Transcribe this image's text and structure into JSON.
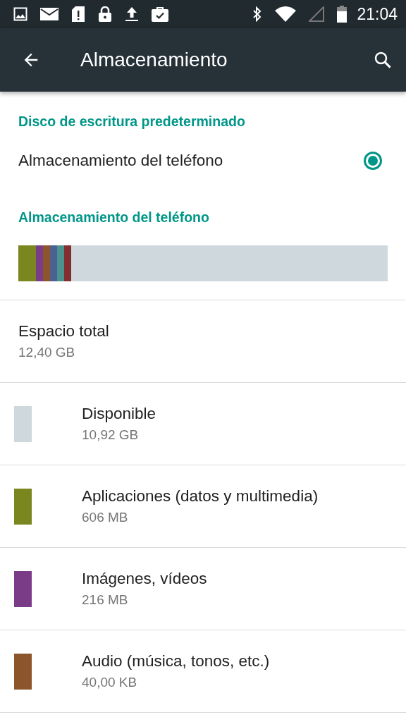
{
  "status_bar": {
    "time": "21:04"
  },
  "app_bar": {
    "title": "Almacenamiento"
  },
  "default_disk": {
    "header": "Disco de escritura predeterminado",
    "options": [
      {
        "label": "Almacenamiento del teléfono",
        "selected": true
      }
    ]
  },
  "phone_storage": {
    "header": "Almacenamiento del teléfono",
    "usage_bar": [
      {
        "color": "#7a861e"
      },
      {
        "color": "#7b3c87"
      },
      {
        "color": "#8d552c"
      },
      {
        "color": "#4a6192"
      },
      {
        "color": "#4a938f"
      },
      {
        "color": "#832f31"
      }
    ],
    "total": {
      "label": "Espacio total",
      "value": "12,40 GB"
    },
    "categories": [
      {
        "label": "Disponible",
        "value": "10,92 GB",
        "color": "#cfd8dc"
      },
      {
        "label": "Aplicaciones (datos y multimedia)",
        "value": "606 MB",
        "color": "#7a861e"
      },
      {
        "label": "Imágenes, vídeos",
        "value": "216 MB",
        "color": "#7b3c87"
      },
      {
        "label": "Audio (música, tonos, etc.)",
        "value": "40,00 KB",
        "color": "#8d552c"
      }
    ]
  }
}
